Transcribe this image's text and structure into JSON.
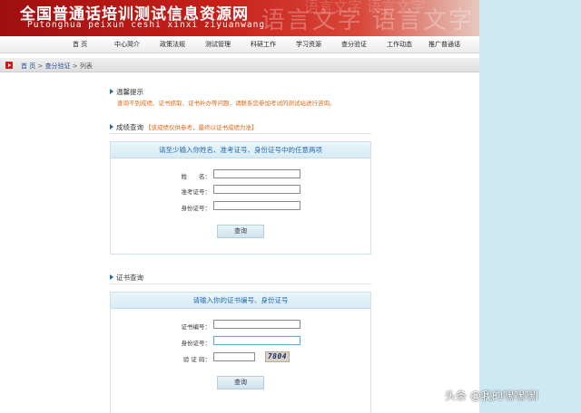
{
  "header": {
    "title": "全国普通话培训测试信息资源网",
    "subtitle": "Putonghua peixun ceshi xinxi ziyuanwang",
    "decor_text": "语言文字 语言文字",
    "background_color": "#c5201a"
  },
  "nav": {
    "items": [
      {
        "label": "首 页"
      },
      {
        "label": "中心简介"
      },
      {
        "label": "政策法规"
      },
      {
        "label": "测试管理"
      },
      {
        "label": "科研工作"
      },
      {
        "label": "学习资源"
      },
      {
        "label": "查分验证"
      },
      {
        "label": "工作动态"
      },
      {
        "label": "推广普通话"
      }
    ]
  },
  "breadcrumb": {
    "icon": "play-icon",
    "home": "首 页",
    "sep1": " > ",
    "section": "查分验证",
    "sep2": " > ",
    "current": "列表"
  },
  "tips": {
    "title": "温馨提示",
    "text": "查询不到成绩、证书抓取、证书补办等问题，请联系您参加考试的测试站进行咨询。"
  },
  "score_query": {
    "title": "成绩查询",
    "note": "【该成绩仅供参考，最终以证书成绩为准】",
    "box_title": "请至少输入你姓名、准考证号、身份证号中的任意两项",
    "fields": [
      {
        "label": "姓　　名：",
        "value": ""
      },
      {
        "label": "准考证号：",
        "value": ""
      },
      {
        "label": "身份证号：",
        "value": ""
      }
    ],
    "button": "查询"
  },
  "cert_query": {
    "title": "证书查询",
    "box_title": "请输入你的证书编号、身份证号",
    "fields": [
      {
        "label": "证书编号：",
        "value": ""
      },
      {
        "label": "身份证号：",
        "value": ""
      },
      {
        "label": "验 证 码：",
        "value": ""
      }
    ],
    "captcha": "7804",
    "button": "查询"
  },
  "watermark": "头条 @我的嘿嘿嘿l",
  "colors": {
    "accent_blue": "#2768b0",
    "hint_orange": "#e06a17",
    "page_bg": "#cfe9f3"
  }
}
